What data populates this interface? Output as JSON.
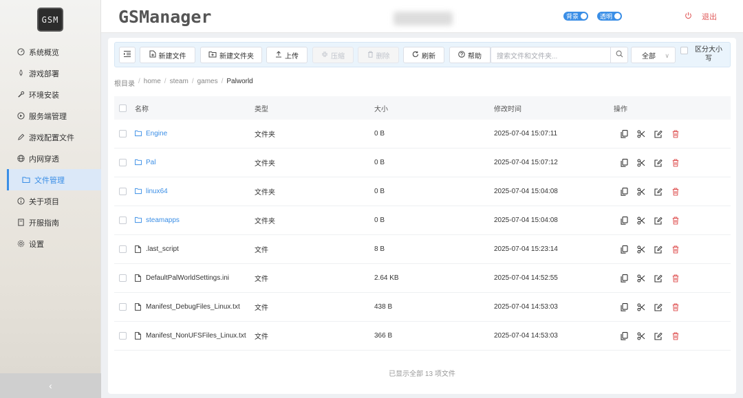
{
  "sidebar": {
    "logo": "GSM",
    "items": [
      {
        "label": "系统概览",
        "icon": "dashboard-icon"
      },
      {
        "label": "游戏部署",
        "icon": "rocket-icon"
      },
      {
        "label": "环境安装",
        "icon": "wrench-icon"
      },
      {
        "label": "服务端管理",
        "icon": "server-icon"
      },
      {
        "label": "游戏配置文件",
        "icon": "pencil-icon"
      },
      {
        "label": "内网穿透",
        "icon": "globe-icon"
      },
      {
        "label": "文件管理",
        "icon": "folder-icon",
        "active": true
      },
      {
        "label": "关于项目",
        "icon": "info-icon"
      },
      {
        "label": "开服指南",
        "icon": "book-icon"
      },
      {
        "label": "设置",
        "icon": "gear-icon"
      }
    ],
    "collapse": "‹"
  },
  "header": {
    "brand": "GSManager",
    "toggle_bg": "背景",
    "toggle_transparent": "透明",
    "logout": "退出"
  },
  "toolbar": {
    "new_file": "新建文件",
    "new_folder": "新建文件夹",
    "upload": "上传",
    "compress": "压缩",
    "delete": "删除",
    "refresh": "刷新",
    "help": "帮助",
    "search_placeholder": "搜索文件和文件夹...",
    "filter": "全部",
    "case_sensitive": "区分大小写"
  },
  "breadcrumb": [
    "根目录",
    "home",
    "steam",
    "games",
    "Palworld"
  ],
  "table": {
    "headers": {
      "name": "名称",
      "type": "类型",
      "size": "大小",
      "mtime": "修改时间",
      "ops": "操作"
    },
    "rows": [
      {
        "name": "Engine",
        "type": "文件夹",
        "size": "0 B",
        "mtime": "2025-07-04 15:07:11",
        "kind": "folder"
      },
      {
        "name": "Pal",
        "type": "文件夹",
        "size": "0 B",
        "mtime": "2025-07-04 15:07:12",
        "kind": "folder"
      },
      {
        "name": "linux64",
        "type": "文件夹",
        "size": "0 B",
        "mtime": "2025-07-04 15:04:08",
        "kind": "folder"
      },
      {
        "name": "steamapps",
        "type": "文件夹",
        "size": "0 B",
        "mtime": "2025-07-04 15:04:08",
        "kind": "folder"
      },
      {
        "name": ".last_script",
        "type": "文件",
        "size": "8 B",
        "mtime": "2025-07-04 15:23:14",
        "kind": "file"
      },
      {
        "name": "DefaultPalWorldSettings.ini",
        "type": "文件",
        "size": "2.64 KB",
        "mtime": "2025-07-04 14:52:55",
        "kind": "file"
      },
      {
        "name": "Manifest_DebugFiles_Linux.txt",
        "type": "文件",
        "size": "438 B",
        "mtime": "2025-07-04 14:53:03",
        "kind": "file"
      },
      {
        "name": "Manifest_NonUFSFiles_Linux.txt",
        "type": "文件",
        "size": "366 B",
        "mtime": "2025-07-04 14:53:03",
        "kind": "file"
      }
    ]
  },
  "footer": "已显示全部 13 项文件",
  "colors": {
    "accent": "#3a8ee6",
    "danger": "#e05a5a"
  }
}
